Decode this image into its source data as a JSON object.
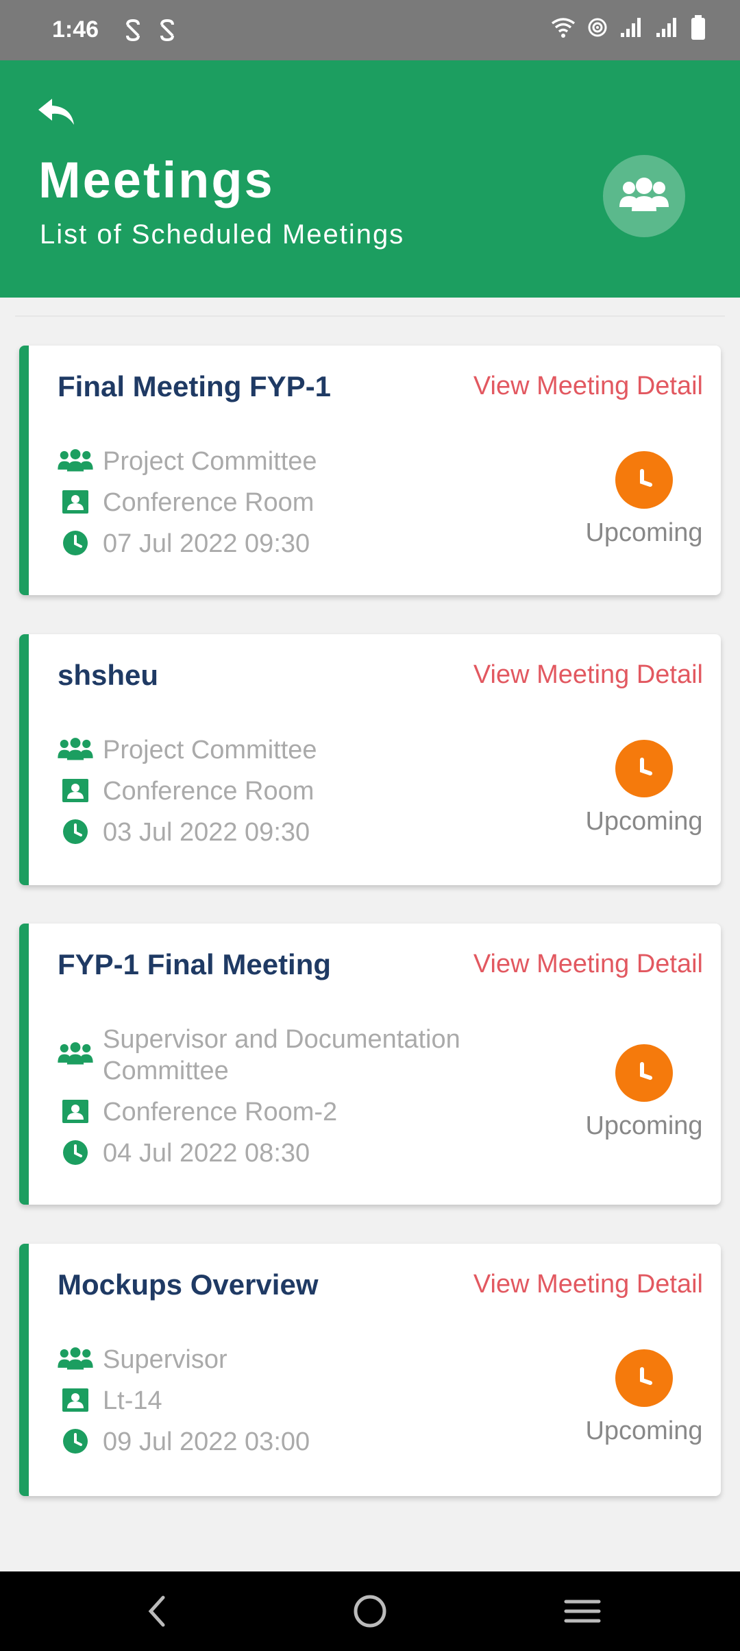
{
  "status_bar": {
    "time": "1:46"
  },
  "header": {
    "title": "Meetings",
    "subtitle": "List of Scheduled Meetings"
  },
  "colors": {
    "accent": "#1c9e60",
    "title_text": "#1f3a64",
    "link": "#e25860",
    "status_orange": "#f57a0c"
  },
  "meetings": [
    {
      "title": "Final Meeting FYP-1",
      "link": "View Meeting Detail",
      "committee": "Project Committee",
      "room": "Conference Room",
      "datetime": "07 Jul 2022 09:30",
      "status": "Upcoming"
    },
    {
      "title": "shsheu",
      "link": "View Meeting Detail",
      "committee": "Project Committee",
      "room": "Conference Room",
      "datetime": "03 Jul 2022 09:30",
      "status": "Upcoming"
    },
    {
      "title": "FYP-1 Final Meeting",
      "link": "View Meeting Detail",
      "committee": "Supervisor and Documentation Committee",
      "room": "Conference Room-2",
      "datetime": "04 Jul 2022 08:30",
      "status": "Upcoming"
    },
    {
      "title": "Mockups Overview",
      "link": "View Meeting Detail",
      "committee": "Supervisor",
      "room": "Lt-14",
      "datetime": "09 Jul 2022 03:00",
      "status": "Upcoming"
    }
  ]
}
